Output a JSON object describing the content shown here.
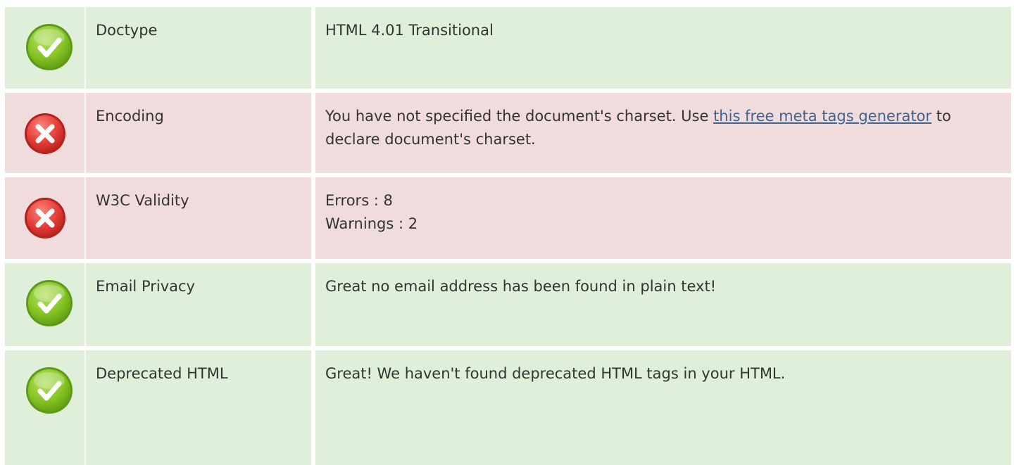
{
  "rows": [
    {
      "status": "pass",
      "icon": "check-icon",
      "name": "Doctype",
      "value": "HTML 4.01 Transitional"
    },
    {
      "status": "fail",
      "icon": "cross-icon",
      "name": "Encoding",
      "value_before": "You have not specified the document's charset. Use ",
      "link_text": "this free meta tags generator",
      "value_after": " to declare document's charset."
    },
    {
      "status": "fail",
      "icon": "cross-icon",
      "name": "W3C Validity",
      "errors": "Errors : 8",
      "warnings": "Warnings : 2"
    },
    {
      "status": "pass",
      "icon": "check-icon",
      "name": "Email Privacy",
      "value": "Great no email address has been found in plain text!"
    },
    {
      "status": "pass",
      "icon": "check-icon",
      "name": "Deprecated HTML",
      "value": "Great! We haven't found deprecated HTML tags in your HTML."
    }
  ],
  "colors": {
    "pass_bg": "#dfefd9",
    "fail_bg": "#f1dcdd",
    "link": "#3d6591",
    "pass_icon": "#7cbd1f",
    "fail_icon": "#e43d36"
  }
}
